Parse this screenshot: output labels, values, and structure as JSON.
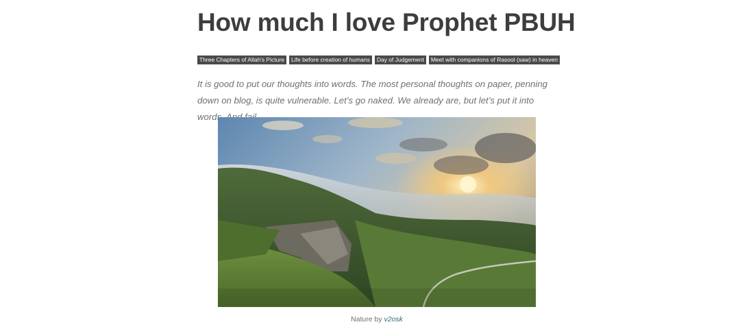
{
  "post": {
    "title": "How much I love Prophet PBUH",
    "tags": [
      "Three Chapters of Allah's Picture",
      "Life before creation of humans",
      "Day of Judgement",
      "Meet with companions of Rasool (saw) in heaven"
    ],
    "intro": "It is good to put our thoughts into words. The most personal thoughts on paper, penning down on blog, is quite vulnerable. Let’s go naked. We already are, but let’s put it into words. And fail.",
    "image": {
      "caption_prefix": "Nature by ",
      "caption_author": "v2osk"
    }
  }
}
